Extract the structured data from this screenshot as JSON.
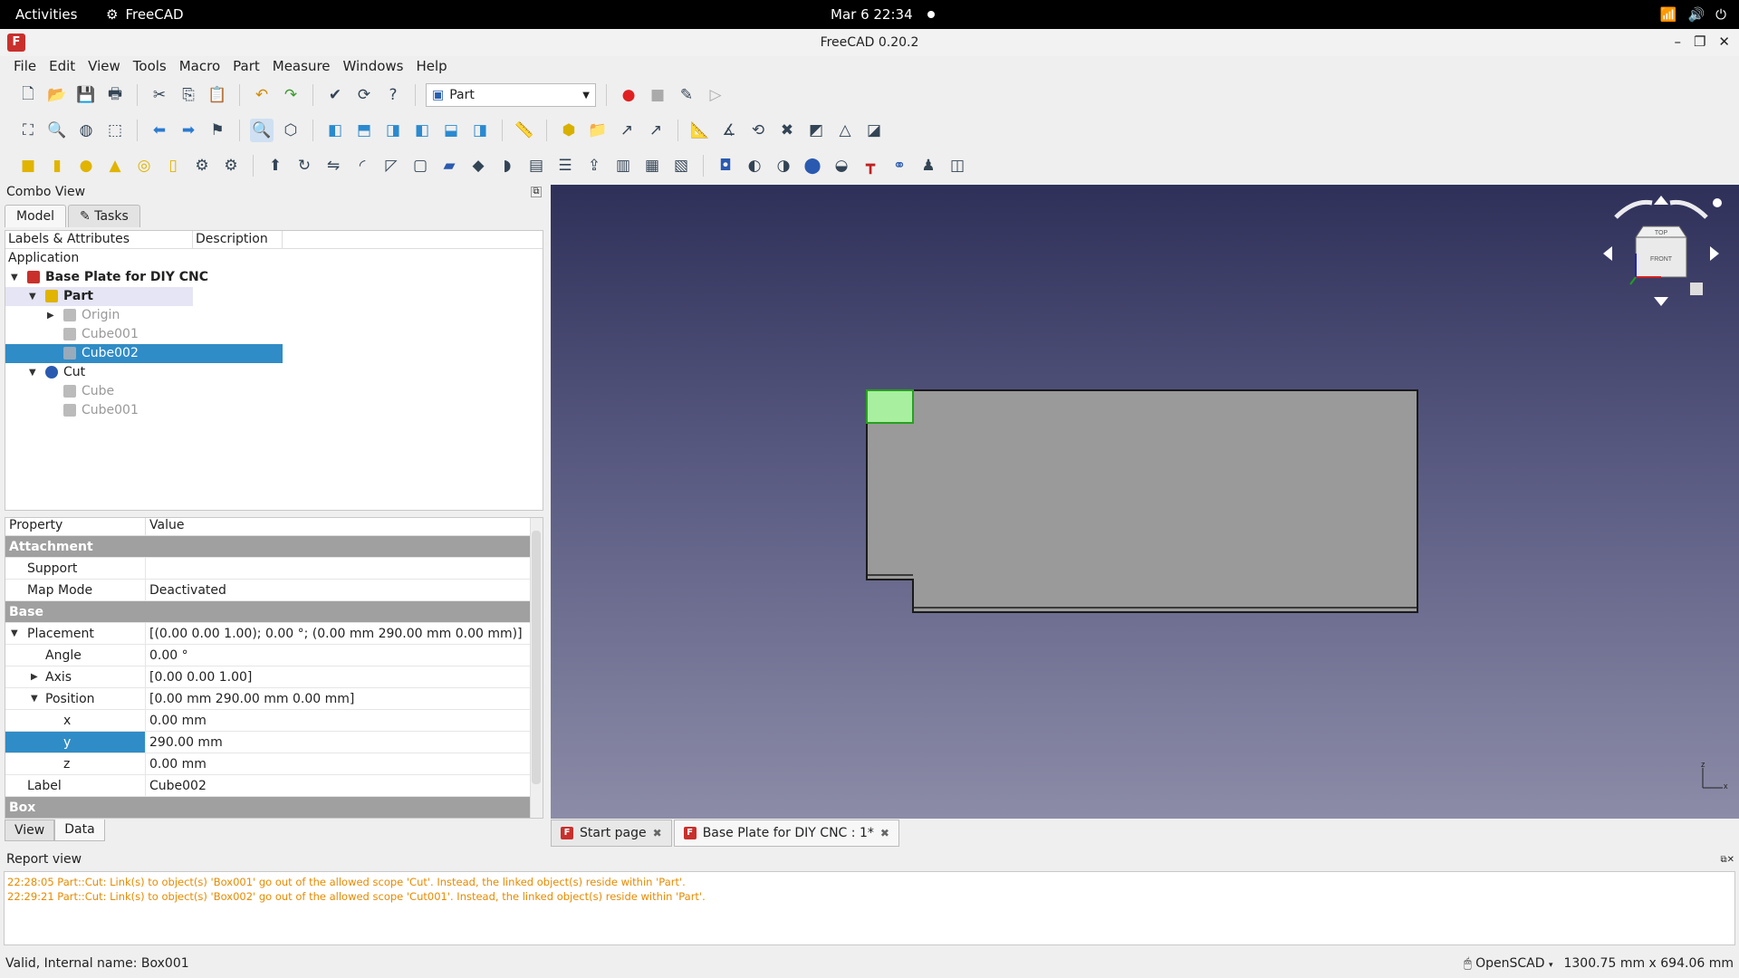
{
  "topbar": {
    "activities": "Activities",
    "app_name": "FreeCAD",
    "clock": "Mar 6  22:34"
  },
  "window": {
    "title": "FreeCAD 0.20.2"
  },
  "menu": [
    "File",
    "Edit",
    "View",
    "Tools",
    "Macro",
    "Part",
    "Measure",
    "Windows",
    "Help"
  ],
  "workbench": {
    "selected": "Part"
  },
  "combo": {
    "title": "Combo View",
    "tab_model": "Model",
    "tab_tasks": "Tasks",
    "tree_header": {
      "labels": "Labels & Attributes",
      "description": "Description"
    },
    "tree": {
      "application": "Application",
      "document": "Base Plate for DIY CNC",
      "part": "Part",
      "origin": "Origin",
      "cube001a": "Cube001",
      "cube002": "Cube002",
      "cut": "Cut",
      "cube": "Cube",
      "cube001b": "Cube001"
    }
  },
  "props": {
    "header": {
      "property": "Property",
      "value": "Value"
    },
    "attachment": "Attachment",
    "support": {
      "label": "Support",
      "value": ""
    },
    "map_mode": {
      "label": "Map Mode",
      "value": "Deactivated"
    },
    "base": "Base",
    "placement": {
      "label": "Placement",
      "value": "[(0.00 0.00 1.00); 0.00 °; (0.00 mm  290.00 mm  0.00 mm)]"
    },
    "angle": {
      "label": "Angle",
      "value": "0.00 °"
    },
    "axis": {
      "label": "Axis",
      "value": "[0.00 0.00 1.00]"
    },
    "position": {
      "label": "Position",
      "value": "[0.00 mm  290.00 mm  0.00 mm]"
    },
    "x": {
      "label": "x",
      "value": "0.00 mm"
    },
    "y": {
      "label": "y",
      "value": "290.00 mm"
    },
    "z": {
      "label": "z",
      "value": "0.00 mm"
    },
    "label": {
      "label": "Label",
      "value": "Cube002"
    },
    "box": "Box",
    "tab_view": "View",
    "tab_data": "Data"
  },
  "navcube": {
    "top": "TOP",
    "front": "FRONT"
  },
  "doc_tabs": {
    "start": "Start page",
    "doc": "Base Plate for DIY CNC : 1*"
  },
  "report": {
    "title": "Report view",
    "lines": [
      "22:28:05  Part::Cut: Link(s) to object(s) 'Box001' go out of the allowed scope 'Cut'. Instead, the linked object(s) reside within 'Part'.",
      "22:29:21  Part::Cut: Link(s) to object(s) 'Box002' go out of the allowed scope 'Cut001'. Instead, the linked object(s) reside within 'Part'."
    ]
  },
  "status": {
    "left": "Valid, Internal name: Box001",
    "nav_style": "OpenSCAD",
    "dimensions": "1300.75 mm x 694.06 mm"
  },
  "colors": {
    "selection": "#308cc6",
    "plate": "#9a9a9a",
    "highlight": "#a8f0a0",
    "report_text": "#e88a00"
  }
}
